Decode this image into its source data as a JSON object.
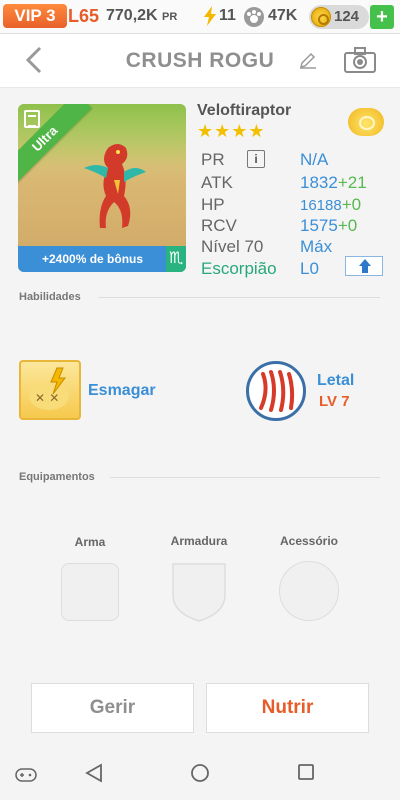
{
  "status": {
    "vip": "VIP 3",
    "level": "L65",
    "power": "770,2K",
    "power_unit": "PR",
    "energy": "11",
    "food": "47K",
    "coins": "124",
    "plus": "+"
  },
  "header": {
    "title": "CRUSH ROGU"
  },
  "creature": {
    "name": "Veloftiraptor",
    "stars": "★★★★",
    "rarity": "Ultra",
    "bonus": "+2400% de bônus",
    "sign_symbol": "♏",
    "stats": [
      {
        "label": "PR",
        "value": "N/A"
      },
      {
        "label": "ATK",
        "value": "1832",
        "bonus": "+21"
      },
      {
        "label": "HP",
        "value": "16188",
        "bonus": "+0"
      },
      {
        "label": "RCV",
        "value": "1575",
        "bonus": "+0"
      },
      {
        "label": "Nível 70",
        "value": "Máx"
      },
      {
        "label": "Escorpião",
        "value": "L0"
      }
    ],
    "info": "i"
  },
  "skills": {
    "title": "Habilidades",
    "items": [
      {
        "label": "Esmagar",
        "icon": "crush-icon"
      },
      {
        "label": "Letal",
        "level": "LV 7",
        "icon": "claw-icon"
      }
    ]
  },
  "equipment": {
    "title": "Equipamentos",
    "slots": [
      {
        "label": "Arma"
      },
      {
        "label": "Armadura"
      },
      {
        "label": "Acessório"
      }
    ]
  },
  "actions": {
    "manage": "Gerir",
    "feed": "Nutrir"
  },
  "colors": {
    "accent": "#3b8fd6",
    "orange": "#e85c2a",
    "green": "#57b94f"
  }
}
